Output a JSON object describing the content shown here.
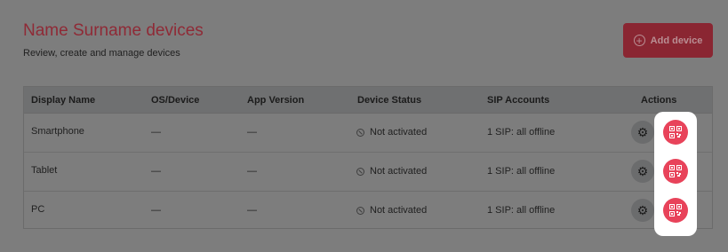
{
  "header": {
    "title": "Name Surname devices",
    "subtitle": "Review, create and manage devices"
  },
  "toolbar": {
    "add_label": "Add device",
    "add_icon": "plus-circle-icon"
  },
  "table": {
    "columns": [
      "Display Name",
      "OS/Device",
      "App Version",
      "Device Status",
      "SIP Accounts",
      "Actions"
    ],
    "rows": [
      {
        "name": "Smartphone",
        "os": "—",
        "version": "—",
        "status": "Not activated",
        "sip": "1 SIP: all offline"
      },
      {
        "name": "Tablet",
        "os": "—",
        "version": "—",
        "status": "Not activated",
        "sip": "1 SIP: all offline"
      },
      {
        "name": "PC",
        "os": "—",
        "version": "—",
        "status": "Not activated",
        "sip": "1 SIP: all offline"
      }
    ],
    "action_icons": [
      "gear-icon",
      "qr-code-icon"
    ]
  },
  "colors": {
    "brand": "#e8435a",
    "overlay": "#7d7d7d"
  }
}
